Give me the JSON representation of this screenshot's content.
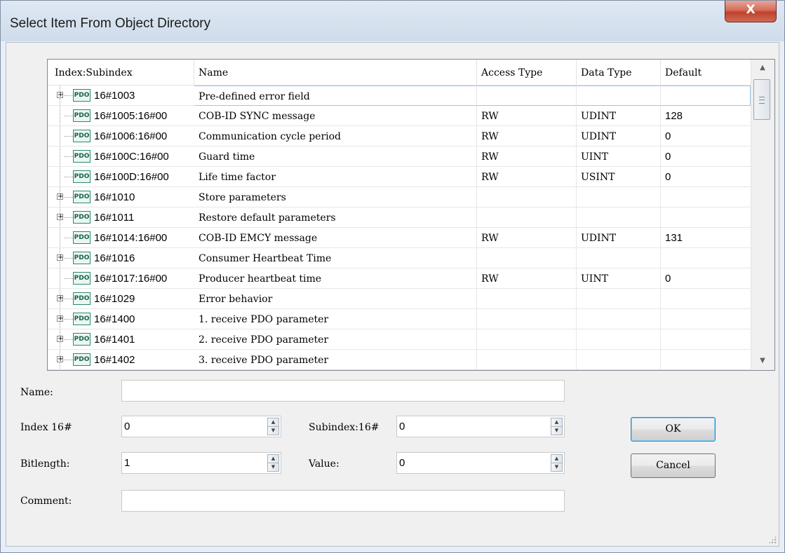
{
  "window": {
    "title": "Select Item From Object Directory",
    "close_glyph": "X"
  },
  "table": {
    "columns": [
      "Index:Subindex",
      "Name",
      "Access Type",
      "Data Type",
      "Default"
    ],
    "rows": [
      {
        "expandable": true,
        "icon": "PDO",
        "index": "16#1003",
        "name": "Pre-defined error field",
        "access": "",
        "dtype": "",
        "default": ""
      },
      {
        "expandable": false,
        "icon": "PDO",
        "index": "16#1005:16#00",
        "name": "COB-ID SYNC message",
        "access": "RW",
        "dtype": "UDINT",
        "default": "128"
      },
      {
        "expandable": false,
        "icon": "PDO",
        "index": "16#1006:16#00",
        "name": "Communication cycle period",
        "access": "RW",
        "dtype": "UDINT",
        "default": "0"
      },
      {
        "expandable": false,
        "icon": "PDO",
        "index": "16#100C:16#00",
        "name": "Guard time",
        "access": "RW",
        "dtype": "UINT",
        "default": "0"
      },
      {
        "expandable": false,
        "icon": "PDO",
        "index": "16#100D:16#00",
        "name": "Life time factor",
        "access": "RW",
        "dtype": "USINT",
        "default": "0"
      },
      {
        "expandable": true,
        "icon": "PDO",
        "index": "16#1010",
        "name": "Store parameters",
        "access": "",
        "dtype": "",
        "default": ""
      },
      {
        "expandable": true,
        "icon": "PDO",
        "index": "16#1011",
        "name": "Restore default parameters",
        "access": "",
        "dtype": "",
        "default": ""
      },
      {
        "expandable": false,
        "icon": "PDO",
        "index": "16#1014:16#00",
        "name": "COB-ID EMCY message",
        "access": "RW",
        "dtype": "UDINT",
        "default": "131"
      },
      {
        "expandable": true,
        "icon": "PDO",
        "index": "16#1016",
        "name": "Consumer Heartbeat Time",
        "access": "",
        "dtype": "",
        "default": ""
      },
      {
        "expandable": false,
        "icon": "PDO",
        "index": "16#1017:16#00",
        "name": "Producer heartbeat time",
        "access": "RW",
        "dtype": "UINT",
        "default": "0"
      },
      {
        "expandable": true,
        "icon": "PDO",
        "index": "16#1029",
        "name": "Error behavior",
        "access": "",
        "dtype": "",
        "default": ""
      },
      {
        "expandable": true,
        "icon": "PDO",
        "index": "16#1400",
        "name": "1. receive PDO parameter",
        "access": "",
        "dtype": "",
        "default": ""
      },
      {
        "expandable": true,
        "icon": "PDO",
        "index": "16#1401",
        "name": "2. receive PDO parameter",
        "access": "",
        "dtype": "",
        "default": ""
      },
      {
        "expandable": true,
        "icon": "PDO",
        "index": "16#1402",
        "name": "3. receive PDO parameter",
        "access": "",
        "dtype": "",
        "default": ""
      }
    ],
    "selected_row": 0
  },
  "form": {
    "name_label": "Name:",
    "name_value": "",
    "index_label": "Index  16#",
    "index_value": "0",
    "subindex_label": "Subindex:16#",
    "subindex_value": "0",
    "bitlength_label": "Bitlength:",
    "bitlength_value": "1",
    "value_label": "Value:",
    "value_value": "0",
    "comment_label": "Comment:",
    "comment_value": ""
  },
  "buttons": {
    "ok": "OK",
    "cancel": "Cancel"
  },
  "icons": {
    "close": "close-icon",
    "scroll_up": "arrow-up-icon",
    "scroll_down": "arrow-down-icon",
    "spin_up": "spin-up-icon",
    "spin_down": "spin-down-icon",
    "pdo": "pdo-object-icon",
    "expand": "plus-expand-icon"
  },
  "colors": {
    "close_button": "#c1412c",
    "selection_border": "#a3c3e6",
    "pdo_icon": "#2a8a6e",
    "default_button_border": "#3c7fb1"
  }
}
